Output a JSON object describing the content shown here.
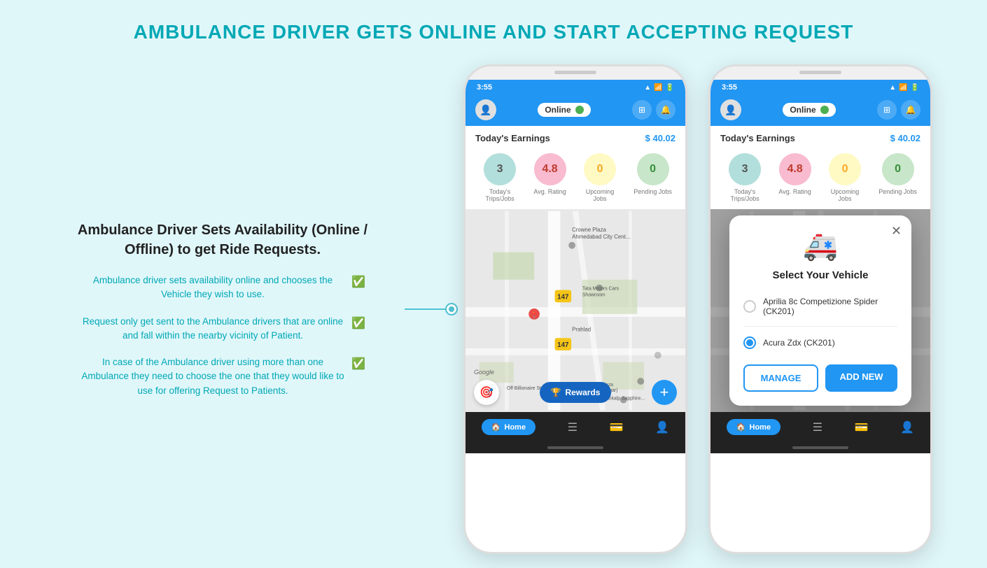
{
  "page": {
    "title": "AMBULANCE DRIVER GETS ONLINE AND START ACCEPTING REQUEST",
    "background_color": "#e0f7fa"
  },
  "left_panel": {
    "heading": "Ambulance Driver Sets Availability (Online / Offline) to get Ride Requests.",
    "features": [
      {
        "text": "Ambulance driver sets availability online and chooses the Vehicle they wish to use."
      },
      {
        "text": "Request only get sent to the Ambulance drivers that are online and fall within the nearby vicinity of Patient."
      },
      {
        "text": "In case of the Ambulance driver using more than one Ambulance they need to choose the one that they would like to use for offering Request to Patients."
      }
    ]
  },
  "phone1": {
    "status_bar": {
      "time": "3:55",
      "icons": [
        "signal",
        "wifi",
        "battery"
      ]
    },
    "header": {
      "online_label": "Online",
      "online_status": "active"
    },
    "earnings": {
      "label": "Today's Earnings",
      "value": "$ 40.02"
    },
    "stats": [
      {
        "value": "3",
        "label": "Today's\nTrips/Jobs",
        "color": "#b2dfdb",
        "text_color": "#555"
      },
      {
        "value": "4.8",
        "label": "Avg. Rating",
        "color": "#f8bbd0",
        "text_color": "#c0392b"
      },
      {
        "value": "0",
        "label": "Upcoming Jobs",
        "color": "#fff9c4",
        "text_color": "#f9a825"
      },
      {
        "value": "0",
        "label": "Pending Jobs",
        "color": "#c8e6c9",
        "text_color": "#388e3c"
      }
    ],
    "map": {
      "google_label": "Google"
    },
    "bottom": {
      "rewards_label": "Rewards",
      "add_label": "+"
    },
    "nav": {
      "home": "Home",
      "items": [
        "list",
        "wallet",
        "profile"
      ]
    }
  },
  "phone2": {
    "status_bar": {
      "time": "3:55",
      "icons": [
        "signal",
        "wifi",
        "battery"
      ]
    },
    "header": {
      "online_label": "Online",
      "online_status": "active"
    },
    "earnings": {
      "label": "Today's Earnings",
      "value": "$ 40.02"
    },
    "stats": [
      {
        "value": "3",
        "label": "Today's\nTrips/Jobs",
        "color": "#b2dfdb",
        "text_color": "#555"
      },
      {
        "value": "4.8",
        "label": "Avg. Rating",
        "color": "#f8bbd0",
        "text_color": "#c0392b"
      },
      {
        "value": "0",
        "label": "Upcoming Jobs",
        "color": "#fff9c4",
        "text_color": "#f9a825"
      },
      {
        "value": "0",
        "label": "Pending Jobs",
        "color": "#c8e6c9",
        "text_color": "#388e3c"
      }
    ],
    "modal": {
      "title": "Select Your Vehicle",
      "vehicle1": {
        "label": "Aprilia 8c Competizione Spider (CK201)",
        "selected": false
      },
      "vehicle2": {
        "label": "Acura Zdx (CK201)",
        "selected": true
      },
      "manage_btn": "MANAGE",
      "add_new_btn": "ADD NEW"
    },
    "nav": {
      "home": "Home",
      "items": [
        "list",
        "wallet",
        "profile"
      ]
    }
  }
}
